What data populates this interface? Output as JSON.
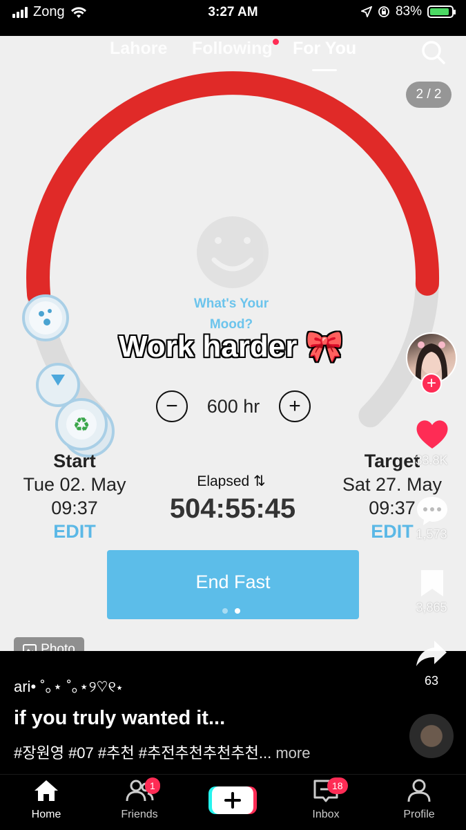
{
  "status_bar": {
    "carrier": "Zong",
    "time": "3:27 AM",
    "battery_percent": "83%"
  },
  "top_nav": {
    "tabs": [
      {
        "label": "Lahore",
        "active": false
      },
      {
        "label": "Following",
        "active": false,
        "has_dot": true
      },
      {
        "label": "For You",
        "active": true
      }
    ]
  },
  "photo": {
    "counter": "2 / 2",
    "badge_label": "Photo",
    "overlay_text": "Work harder 🎀",
    "app": {
      "mood_prompt": "What's Your Mood?",
      "duration_value": "600 hr",
      "start": {
        "heading": "Start",
        "date": "Tue 02. May",
        "time": "09:37",
        "edit": "EDIT"
      },
      "target": {
        "heading": "Target",
        "date": "Sat 27. May",
        "time": "09:37",
        "edit": "EDIT"
      },
      "elapsed_label": "Elapsed ⇅",
      "elapsed_value": "504:55:45",
      "end_button": "End Fast",
      "progress_fraction": 0.84,
      "colors": {
        "arc": "#e02a28",
        "track": "#dcdcdc",
        "accent": "#5cbde9"
      }
    }
  },
  "rail": {
    "likes": "33.8K",
    "comments": "1,573",
    "saves": "3,865",
    "shares": "63"
  },
  "post": {
    "username": "ari• ˚｡⋆ ˚｡⋆୨♡୧⋆",
    "caption": "if you truly wanted it...",
    "hashtags": "#장원영 #07 #추천 #추전추천추천추천...",
    "more": "more"
  },
  "bottom_nav": {
    "items": [
      {
        "label": "Home",
        "icon": "home-icon"
      },
      {
        "label": "Friends",
        "icon": "friends-icon",
        "badge": "1"
      },
      {
        "label": "Inbox",
        "icon": "inbox-icon",
        "badge": "18"
      },
      {
        "label": "Profile",
        "icon": "profile-icon"
      }
    ]
  }
}
